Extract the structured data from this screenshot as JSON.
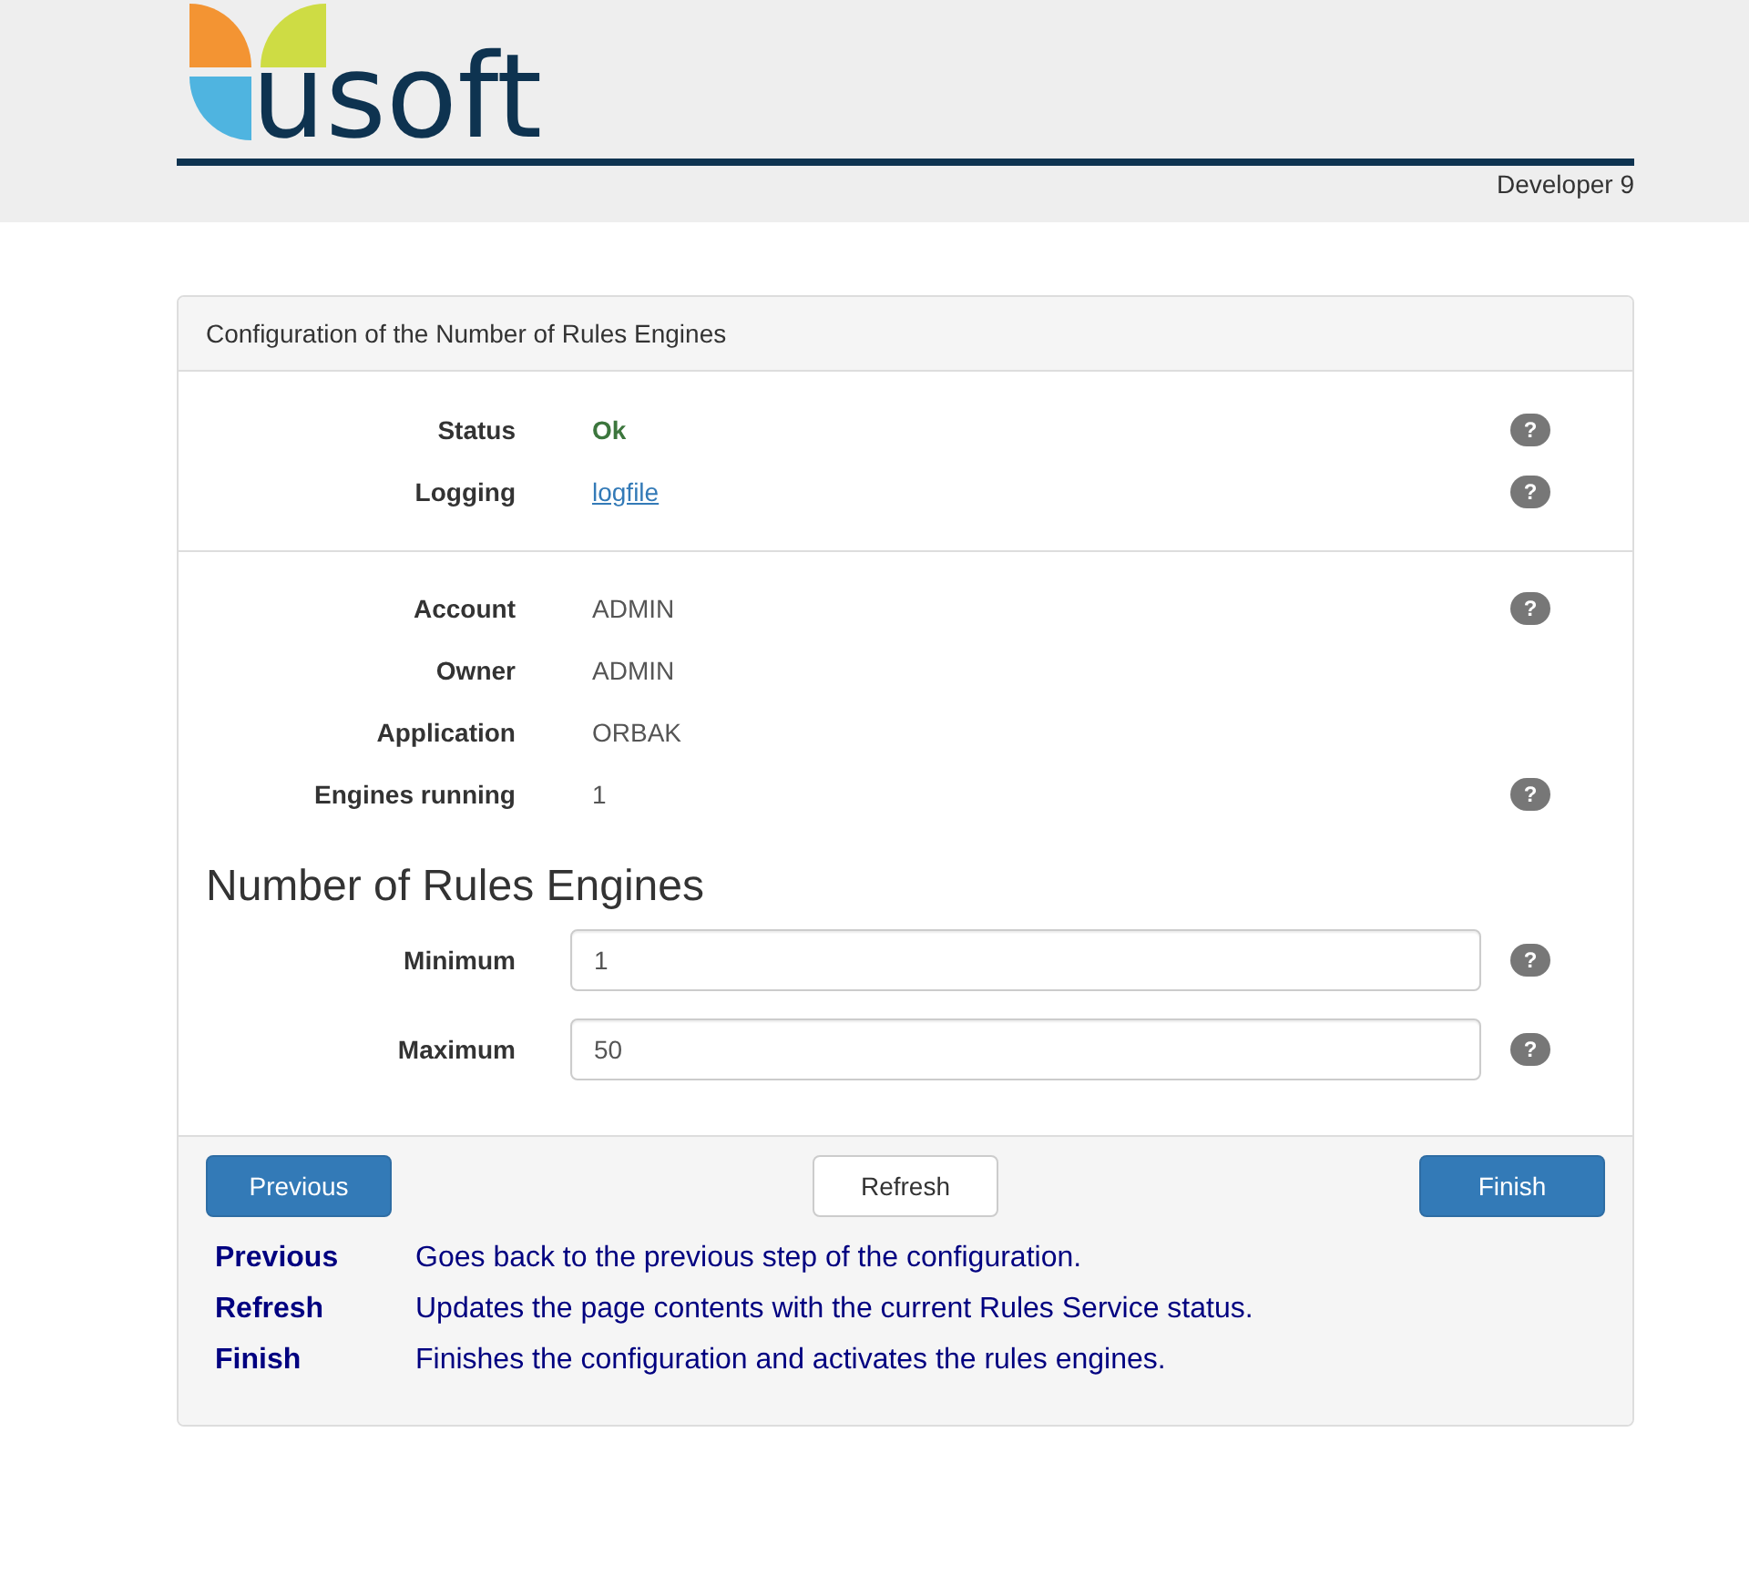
{
  "header": {
    "logo_text": "usoft",
    "user": "Developer 9"
  },
  "panel": {
    "title": "Configuration of the Number of Rules Engines",
    "status_rows": [
      {
        "label": "Status",
        "kind": "status",
        "value": "Ok",
        "help": "?"
      },
      {
        "label": "Logging",
        "kind": "link",
        "value": "logfile",
        "help": "?"
      }
    ],
    "info_rows": [
      {
        "label": "Account",
        "kind": "text",
        "value": "ADMIN",
        "help": "?"
      },
      {
        "label": "Owner",
        "kind": "text",
        "value": "ADMIN"
      },
      {
        "label": "Application",
        "kind": "text",
        "value": "ORBAK"
      },
      {
        "label": "Engines running",
        "kind": "text",
        "value": "1",
        "help": "?"
      }
    ],
    "heading": "Number of Rules Engines",
    "fields": [
      {
        "label": "Minimum",
        "value": "1",
        "help": "?"
      },
      {
        "label": "Maximum",
        "value": "50",
        "help": "?"
      }
    ],
    "buttons": [
      {
        "label": "Previous",
        "kind": "primary"
      },
      {
        "label": "Refresh",
        "kind": "default"
      },
      {
        "label": "Finish",
        "kind": "primary"
      }
    ],
    "legend": [
      {
        "term": "Previous",
        "description": "Goes back to the previous step of the configuration."
      },
      {
        "term": "Refresh",
        "description": "Updates the page contents with the current Rules Service status."
      },
      {
        "term": "Finish",
        "description": "Finishes the configuration and activates the rules engines."
      }
    ]
  }
}
